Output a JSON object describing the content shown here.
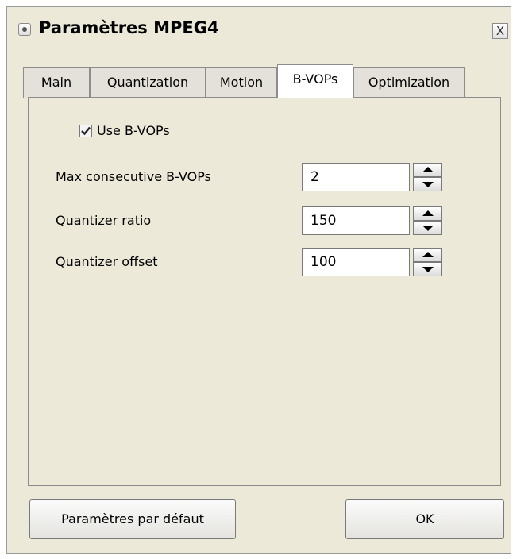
{
  "window": {
    "title": "Paramètres MPEG4",
    "close_glyph": "X"
  },
  "tabs": [
    {
      "label": "Main"
    },
    {
      "label": "Quantization"
    },
    {
      "label": "Motion"
    },
    {
      "label": "B-VOPs"
    },
    {
      "label": "Optimization"
    }
  ],
  "active_tab": "B-VOPs",
  "use_bvops": {
    "label": "Use B-VOPs",
    "checked": true
  },
  "fields": [
    {
      "label": "Max consecutive B-VOPs",
      "value": "2"
    },
    {
      "label": "Quantizer ratio",
      "value": "150"
    },
    {
      "label": "Quantizer offset",
      "value": "100"
    }
  ],
  "buttons": {
    "defaults_label": "Paramètres par défaut",
    "ok_label": "OK"
  },
  "icons": {
    "system_menu": "system-menu-icon",
    "close": "close-icon",
    "checkmark": "checkmark-icon",
    "spin_up": "arrow-up-icon",
    "spin_down": "arrow-down-icon"
  }
}
